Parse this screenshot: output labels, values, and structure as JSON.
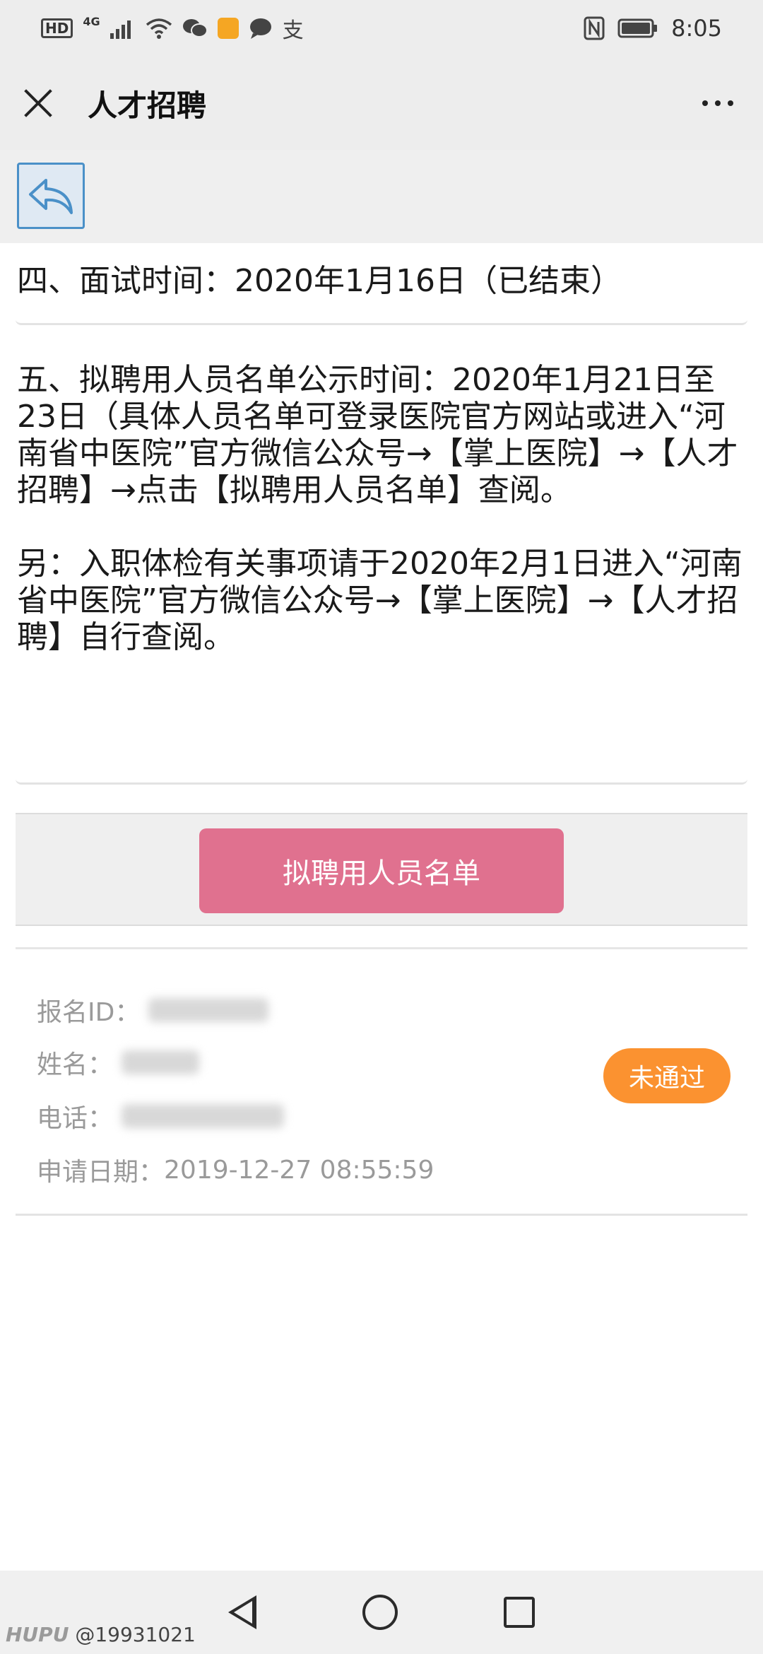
{
  "status_bar": {
    "hd": "HD",
    "network": "4G",
    "alipay_glyph": "支",
    "time": "8:05",
    "icons": [
      "hd-icon",
      "signal-icon",
      "wifi-icon",
      "wechat-icon",
      "app-icon",
      "chat-icon",
      "alipay-icon",
      "nfc-icon",
      "battery-icon"
    ]
  },
  "header": {
    "title": "人才招聘",
    "close_icon": "close-icon",
    "more_icon": "more-dots-icon"
  },
  "back_button_icon": "reply-arrow-icon",
  "notice": {
    "item4": "四、面试时间：2020年1月16日（已结束）",
    "item5": "五、拟聘用人员名单公示时间：2020年1月21日至23日（具体人员名单可登录医院官方网站或进入“河南省中医院”官方微信公众号→【掌上医院】→【人才招聘】→点击【拟聘用人员名单】查阅。",
    "extra": "另：入职体检有关事项请于2020年2月1日进入“河南省中医院”官方微信公众号→【掌上医院】→【人才招聘】自行查阅。"
  },
  "list_button": "拟聘用人员名单",
  "record": {
    "id_label": "报名ID：",
    "name_label": "姓名：",
    "phone_label": "电话：",
    "date_label": "申请日期：",
    "date_value": "2019-12-27 08:55:59",
    "status": "未通过",
    "status_color": "#fb9230"
  },
  "watermark": {
    "brand": "HUPU",
    "user": "@19931021"
  }
}
